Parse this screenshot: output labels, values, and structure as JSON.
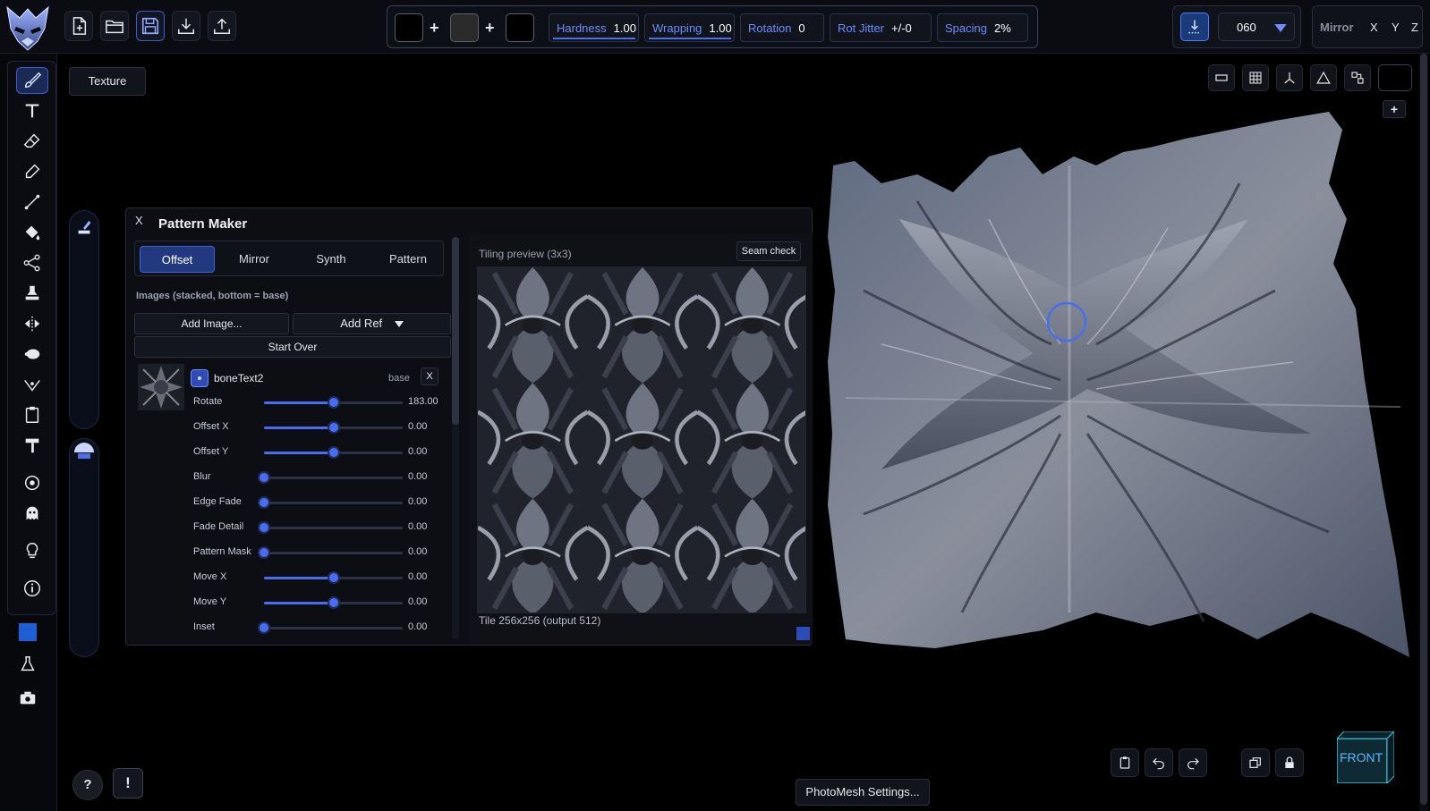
{
  "toolbar": {
    "file_buttons": [
      "new-file-icon",
      "open-folder-icon",
      "save-icon",
      "download-icon",
      "upload-icon"
    ],
    "brush": {
      "swatches": [
        "#000000",
        "#2a2a2a",
        "#000000"
      ],
      "hardness_label": "Hardness",
      "hardness_value": "1.00",
      "wrapping_label": "Wrapping",
      "wrapping_value": "1.00",
      "rotation_label": "Rotation",
      "rotation_value": "0",
      "rot_jitter_label": "Rot Jitter",
      "rot_jitter_value": "+/-0",
      "spacing_label": "Spacing",
      "spacing_value": "2%"
    },
    "size_value": "060",
    "mirror_label": "Mirror",
    "mirror_axes": [
      "X",
      "Y",
      "Z"
    ]
  },
  "texture_button": "Texture",
  "left_tools": [
    "paint-brush-icon",
    "text-tool-icon",
    "eraser-icon",
    "eyedropper-icon",
    "line-tool-icon",
    "fill-bucket-icon",
    "node-tool-icon",
    "stamp-icon",
    "symmetry-icon",
    "blob-icon",
    "vertex-icon",
    "clipboard-icon",
    "hammer-icon",
    "target-icon",
    "ghost-icon",
    "lightbulb-icon",
    "info-icon",
    "color-square-icon",
    "flask-icon",
    "camera-icon"
  ],
  "pattern_maker": {
    "close": "X",
    "title": "Pattern Maker",
    "tabs": [
      "Offset",
      "Mirror",
      "Synth",
      "Pattern"
    ],
    "active_tab": "Offset",
    "images_label": "Images (stacked, bottom = base)",
    "add_image": "Add Image...",
    "add_ref": "Add Ref",
    "start_over": "Start Over",
    "layer": {
      "name": "boneText2",
      "tag": "base",
      "remove": "X"
    },
    "sliders": [
      {
        "name": "Rotate",
        "value": "183.00",
        "pos": 0.5
      },
      {
        "name": "Offset X",
        "value": "0.00",
        "pos": 0.5
      },
      {
        "name": "Offset Y",
        "value": "0.00",
        "pos": 0.5
      },
      {
        "name": "Blur",
        "value": "0.00",
        "pos": 0.0
      },
      {
        "name": "Edge Fade",
        "value": "0.00",
        "pos": 0.0
      },
      {
        "name": "Fade Detail",
        "value": "0.00",
        "pos": 0.0
      },
      {
        "name": "Pattern Mask",
        "value": "0.00",
        "pos": 0.0
      },
      {
        "name": "Move X",
        "value": "0.00",
        "pos": 0.5
      },
      {
        "name": "Move Y",
        "value": "0.00",
        "pos": 0.5
      },
      {
        "name": "Inset",
        "value": "0.00",
        "pos": 0.0
      }
    ],
    "preview_label": "Tiling preview (3x3)",
    "seam_check": "Seam check",
    "tile_info": "Tile 256x256  (output 512)"
  },
  "viewport": {
    "plus": "+",
    "cube_label": "FRONT",
    "photomesh": "PhotoMesh Settings..."
  },
  "help": "?",
  "alert": "!"
}
